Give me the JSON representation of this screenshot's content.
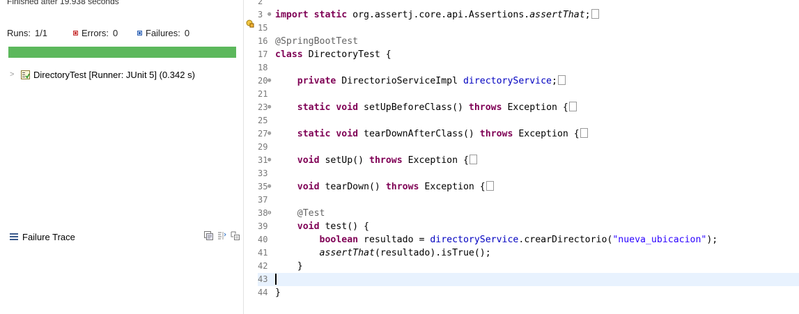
{
  "junit": {
    "status_text": "Finished after 19.938 seconds",
    "runs_label": "Runs:",
    "runs_value": "1/1",
    "errors_label": "Errors:",
    "errors_value": "0",
    "failures_label": "Failures:",
    "failures_value": "0",
    "progress_fraction": 1.0,
    "progress_color": "#5cb85c",
    "tree_item": "DirectoryTest [Runner: JUnit 5] (0.342 s)",
    "failure_trace_label": "Failure Trace"
  },
  "editor": {
    "lines": [
      {
        "num": "2",
        "text": ""
      },
      {
        "num": "3",
        "text": "import static org.assertj.core.api.Assertions.assertThat;"
      },
      {
        "num": "15",
        "text": ""
      },
      {
        "num": "16",
        "text": "@SpringBootTest"
      },
      {
        "num": "17",
        "text": "class DirectoryTest {"
      },
      {
        "num": "18",
        "text": ""
      },
      {
        "num": "20",
        "text": "private DirectorioServiceImpl directoryService;"
      },
      {
        "num": "21",
        "text": ""
      },
      {
        "num": "23",
        "text": "static void setUpBeforeClass() throws Exception {"
      },
      {
        "num": "25",
        "text": ""
      },
      {
        "num": "27",
        "text": "static void tearDownAfterClass() throws Exception {"
      },
      {
        "num": "29",
        "text": ""
      },
      {
        "num": "31",
        "text": "void setUp() throws Exception {"
      },
      {
        "num": "33",
        "text": ""
      },
      {
        "num": "35",
        "text": "void tearDown() throws Exception {"
      },
      {
        "num": "37",
        "text": ""
      },
      {
        "num": "38",
        "text": "@Test"
      },
      {
        "num": "39",
        "text": "void test() {"
      },
      {
        "num": "40",
        "text": "boolean resultado = directoryService.crearDirectorio(\"nueva_ubicacion\");"
      },
      {
        "num": "41",
        "text": "assertThat(resultado).isTrue();"
      },
      {
        "num": "42",
        "text": "}"
      },
      {
        "num": "43",
        "text": ""
      },
      {
        "num": "44",
        "text": "}"
      }
    ]
  }
}
